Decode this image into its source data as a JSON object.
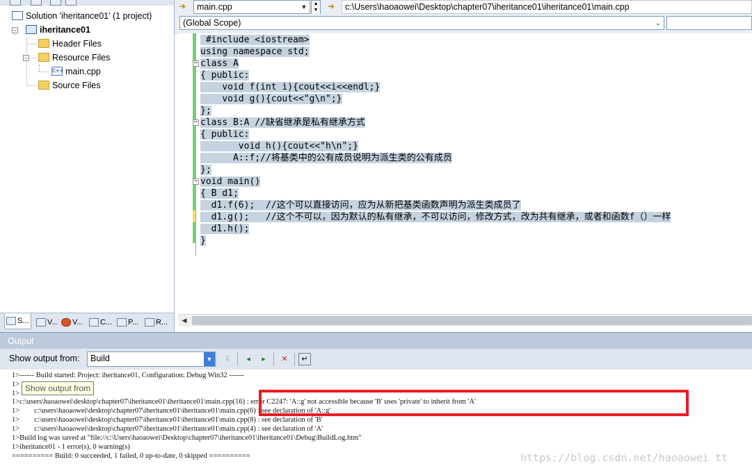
{
  "solution_explorer": {
    "solution_label": "Solution 'iheritance01' (1 project)",
    "project_label": "iheritance01",
    "folders": {
      "header": "Header Files",
      "resource": "Resource Files",
      "source": "Source Files"
    },
    "file_label": "main.cpp",
    "bottom_tabs": [
      "S...",
      "V...",
      "V...",
      "C...",
      "P...",
      "R..."
    ]
  },
  "editor": {
    "file_combo": "main.cpp",
    "path": "c:\\Users\\haoaowei\\Desktop\\chapter07\\iheritance01\\iheritance01\\main.cpp",
    "scope_combo": "(Global Scope)",
    "code_lines": [
      " #include <iostream>",
      "using namespace std;",
      "class A",
      "{ public:",
      "    void f(int i){cout<<i<<endl;}",
      "    void g(){cout<<\"g\\n\";}",
      "};",
      "class B:A //缺省继承是私有继承方式",
      "{ public:",
      "       void h(){cout<<\"h\\n\";}",
      "      A::f;//将基类中的公有成员说明为派生类的公有成员",
      "};",
      "void main()",
      "{ B d1;",
      "  d1.f(6);  //这个可以直接访问，应为从新把基类函数声明为派生类成员了",
      "  d1.g();   //这个不可以，因为默认的私有继承，不可以访问，修改方式，改为共有继承，或者和函数f（）一样",
      "  d1.h();",
      "}"
    ]
  },
  "output": {
    "title": "Output",
    "show_output_from_label": "Show output from:",
    "source": "Build",
    "tooltip": "Show output from",
    "lines": [
      "1>------ Build started: Project: iheritance01, Configuration: Debug Win32 ------",
      "1>",
      "1>",
      "1>c:\\users\\haoaowei\\desktop\\chapter07\\iheritance01\\iheritance01\\main.cpp(16) : error C2247: 'A::g' not accessible because 'B' uses 'private' to inherit from 'A'",
      "1>        c:\\users\\haoaowei\\desktop\\chapter07\\iheritance01\\iheritance01\\main.cpp(6) : see declaration of 'A::g'",
      "1>        c:\\users\\haoaowei\\desktop\\chapter07\\iheritance01\\iheritance01\\main.cpp(8) : see declaration of 'B'",
      "1>        c:\\users\\haoaowei\\desktop\\chapter07\\iheritance01\\iheritance01\\main.cpp(4) : see declaration of 'A'",
      "1>Build log was saved at \"file://c:\\Users\\haoaowei\\Desktop\\chapter07\\iheritance01\\iheritance01\\Debug\\BuildLog.htm\"",
      "1>iheritance01 - 1 error(s), 0 warning(s)",
      "========== Build: 0 succeeded, 1 failed, 0 up-to-date, 0 skipped =========="
    ]
  },
  "watermark": "https://blog.csdn.net/haoaowei tt",
  "colors": {
    "selection": "#c5d3e0",
    "error_box": "#e81c24",
    "change_bar": "#6fd36f",
    "panel_bg": "#dfe6ef"
  }
}
